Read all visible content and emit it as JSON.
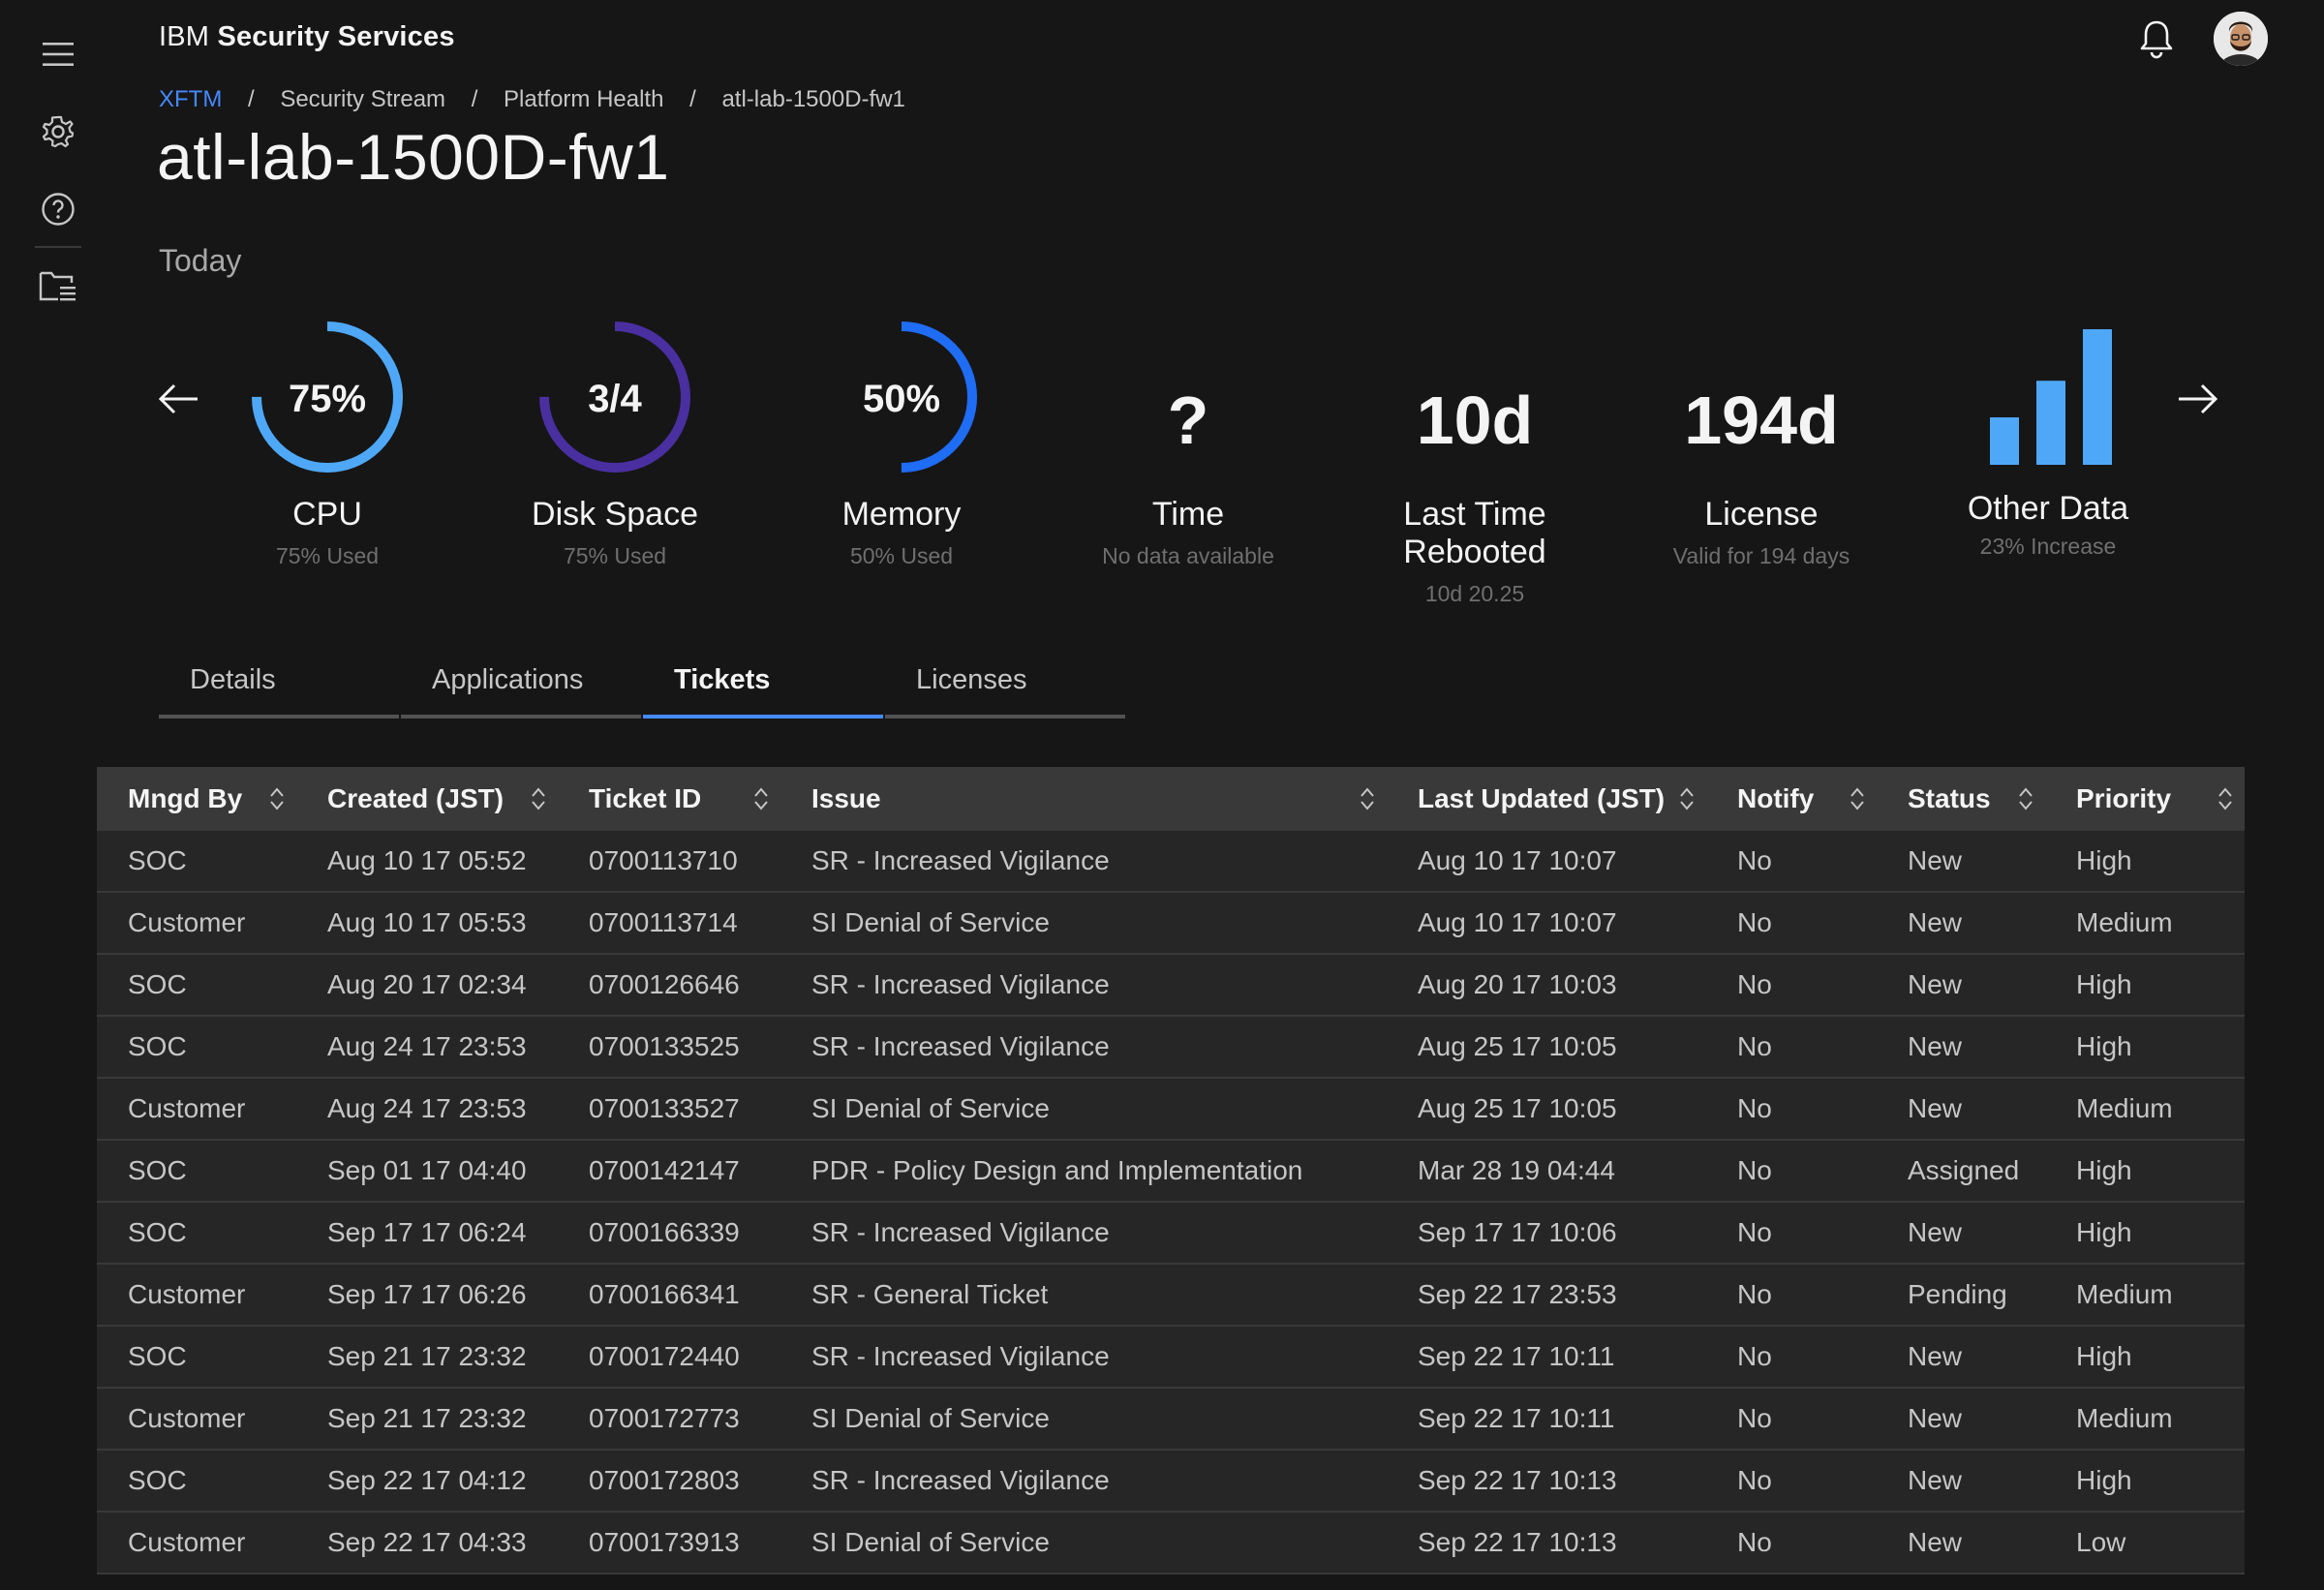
{
  "header": {
    "brand_prefix": "IBM",
    "brand_name": "Security Services"
  },
  "breadcrumb": [
    "XFTM",
    "Security Stream",
    "Platform Health",
    "atl-lab-1500D-fw1"
  ],
  "breadcrumb_separator": "/",
  "page": {
    "title": "atl-lab-1500D-fw1",
    "period": "Today"
  },
  "colors": {
    "accent": "#4589ff",
    "cpu_ring": "#4fa8f7",
    "disk_ring": "#4a2fa0",
    "memory_ring": "#1f6cf5",
    "bars": "#4fa8f7"
  },
  "metrics": {
    "cpu": {
      "value": "75%",
      "name": "CPU",
      "sub": "75% Used",
      "fraction": 0.75
    },
    "disk": {
      "value": "3/4",
      "name": "Disk Space",
      "sub": "75% Used",
      "fraction": 0.75
    },
    "memory": {
      "value": "50%",
      "name": "Memory",
      "sub": "50% Used",
      "fraction": 0.5
    },
    "time": {
      "value": "?",
      "name": "Time",
      "sub": "No data available"
    },
    "rebooted": {
      "value": "10d",
      "name": "Last Time Rebooted",
      "sub": "10d 20.25"
    },
    "license": {
      "value": "194d",
      "name": "License",
      "sub": "Valid for 194 days"
    },
    "other": {
      "name": "Other Data",
      "sub": "23% Increase",
      "bar_levels": [
        0.35,
        0.62,
        1.0
      ]
    }
  },
  "tabs": [
    {
      "label": "Details",
      "active": false
    },
    {
      "label": "Applications",
      "active": false
    },
    {
      "label": "Tickets",
      "active": true
    },
    {
      "label": "Licenses",
      "active": false
    }
  ],
  "table": {
    "columns": [
      "Mngd By",
      "Created (JST)",
      "Ticket ID",
      "Issue",
      "Last Updated (JST)",
      "Notify",
      "Status",
      "Priority"
    ],
    "rows": [
      [
        "SOC",
        "Aug 10 17 05:52",
        "0700113710",
        "SR - Increased Vigilance",
        "Aug 10 17 10:07",
        "No",
        "New",
        "High"
      ],
      [
        "Customer",
        "Aug 10 17 05:53",
        "0700113714",
        "SI Denial of Service",
        "Aug 10 17 10:07",
        "No",
        "New",
        "Medium"
      ],
      [
        "SOC",
        "Aug 20 17 02:34",
        "0700126646",
        "SR - Increased Vigilance",
        "Aug 20 17 10:03",
        "No",
        "New",
        "High"
      ],
      [
        "SOC",
        "Aug 24 17 23:53",
        "0700133525",
        "SR - Increased Vigilance",
        "Aug 25 17 10:05",
        "No",
        "New",
        "High"
      ],
      [
        "Customer",
        "Aug 24 17 23:53",
        "0700133527",
        "SI Denial of Service",
        "Aug 25 17 10:05",
        "No",
        "New",
        "Medium"
      ],
      [
        "SOC",
        "Sep 01 17 04:40",
        "0700142147",
        "PDR - Policy Design and Implementation",
        "Mar 28 19 04:44",
        "No",
        "Assigned",
        "High"
      ],
      [
        "SOC",
        "Sep 17 17 06:24",
        "0700166339",
        "SR - Increased Vigilance",
        "Sep 17 17 10:06",
        "No",
        "New",
        "High"
      ],
      [
        "Customer",
        "Sep 17 17 06:26",
        "0700166341",
        "SR - General Ticket",
        "Sep 22 17 23:53",
        "No",
        "Pending",
        "Medium"
      ],
      [
        "SOC",
        "Sep 21 17 23:32",
        "0700172440",
        "SR - Increased Vigilance",
        "Sep 22 17 10:11",
        "No",
        "New",
        "High"
      ],
      [
        "Customer",
        "Sep 21 17 23:32",
        "0700172773",
        "SI Denial of Service",
        "Sep 22 17 10:11",
        "No",
        "New",
        "Medium"
      ],
      [
        "SOC",
        "Sep 22 17 04:12",
        "0700172803",
        "SR - Increased Vigilance",
        "Sep 22 17 10:13",
        "No",
        "New",
        "High"
      ],
      [
        "Customer",
        "Sep 22 17 04:33",
        "0700173913",
        "SI Denial of Service",
        "Sep 22 17 10:13",
        "No",
        "New",
        "Low"
      ]
    ]
  },
  "icons": [
    "menu-icon",
    "settings-icon",
    "help-icon",
    "folder-list-icon",
    "notification-icon",
    "arrow-left-icon",
    "arrow-right-icon",
    "sort-icon"
  ]
}
